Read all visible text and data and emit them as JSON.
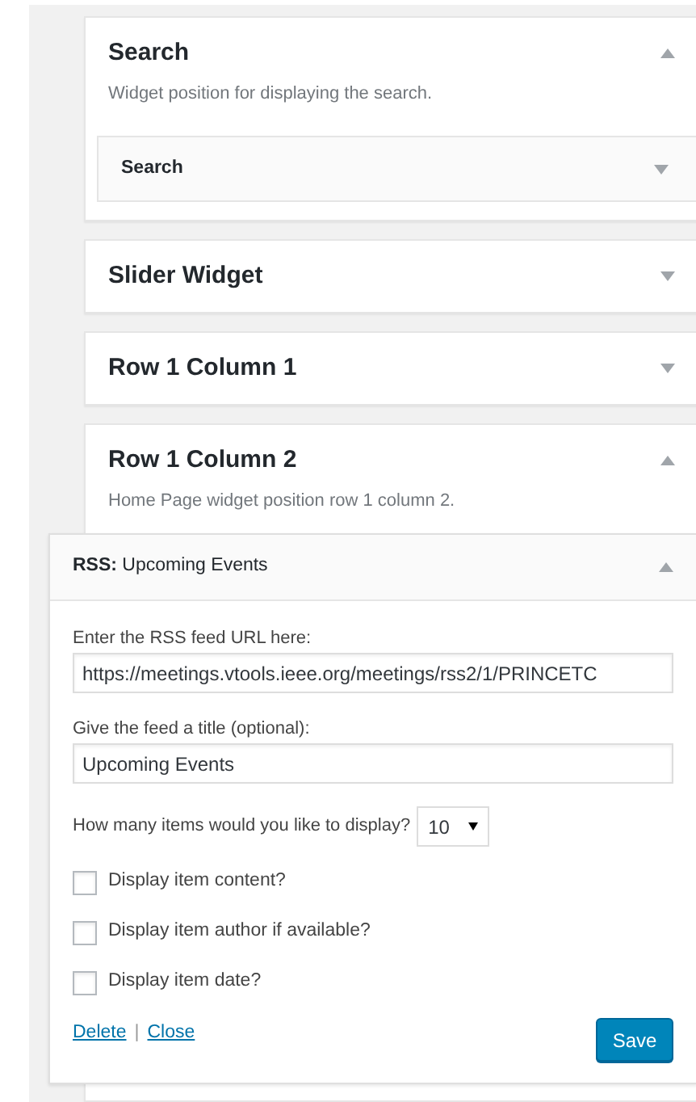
{
  "sidebars": [
    {
      "title": "Search",
      "expanded": true,
      "description": "Widget position for displaying the search.",
      "widgets": [
        {
          "title": "Search",
          "expanded": false
        }
      ]
    },
    {
      "title": "Slider Widget",
      "expanded": false
    },
    {
      "title": "Row 1 Column 1",
      "expanded": false
    },
    {
      "title": "Row 1 Column 2",
      "expanded": true,
      "description": "Home Page widget position row 1 column 2.",
      "widgets": [
        {
          "title": "**RSS:** Upcoming Events",
          "expanded": true,
          "form": {
            "url_label": "Enter the RSS feed URL here:",
            "url_value": "https://meetings.vtools.ieee.org/meetings/rss2/1/PRINCETC",
            "title_label": "Give the feed a title (optional):",
            "title_value": "Upcoming Events",
            "items_label": "How many items would you like to display?",
            "items_value": "10",
            "checkboxes": [
              {
                "label": "Display item content?",
                "checked": false
              },
              {
                "label": "Display item author if available?",
                "checked": false
              },
              {
                "label": "Display item date?",
                "checked": false
              }
            ],
            "links": [
              "Delete",
              "Close"
            ],
            "separator": "|",
            "save": "Save"
          }
        }
      ]
    }
  ]
}
